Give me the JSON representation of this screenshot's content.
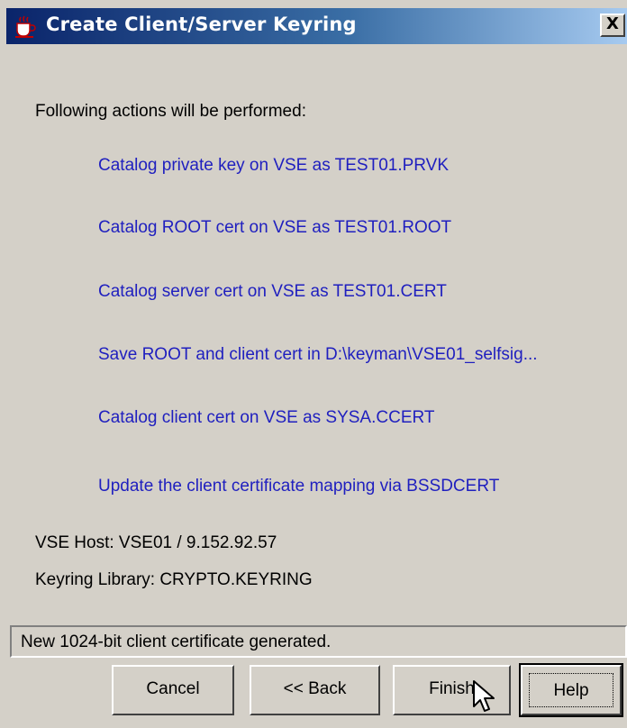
{
  "window": {
    "title": "Create Client/Server Keyring",
    "close_label": "X"
  },
  "content": {
    "heading": "Following actions will be performed:",
    "actions": [
      "Catalog private key on VSE as TEST01.PRVK",
      "Catalog ROOT cert on VSE as TEST01.ROOT",
      "Catalog server cert on VSE as TEST01.CERT",
      "Save ROOT and client cert in D:\\keyman\\VSE01_selfsig...",
      "Catalog client cert on VSE as SYSA.CCERT",
      "Update the client certificate mapping via BSSDCERT"
    ],
    "vse_host": "VSE Host: VSE01 / 9.152.92.57",
    "keyring_library": "Keyring Library: CRYPTO.KEYRING"
  },
  "status": {
    "text": "New 1024-bit client certificate generated."
  },
  "buttons": {
    "cancel": "Cancel",
    "back": "<< Back",
    "finish": "Finish",
    "help": "Help"
  },
  "colors": {
    "action_text": "#1f1fbf",
    "title_start": "#0a246a",
    "title_end": "#a6caf0",
    "window_bg": "#d4d0c8"
  },
  "icons": {
    "app": "java-cup-icon",
    "pointer": "mouse-pointer-icon"
  }
}
